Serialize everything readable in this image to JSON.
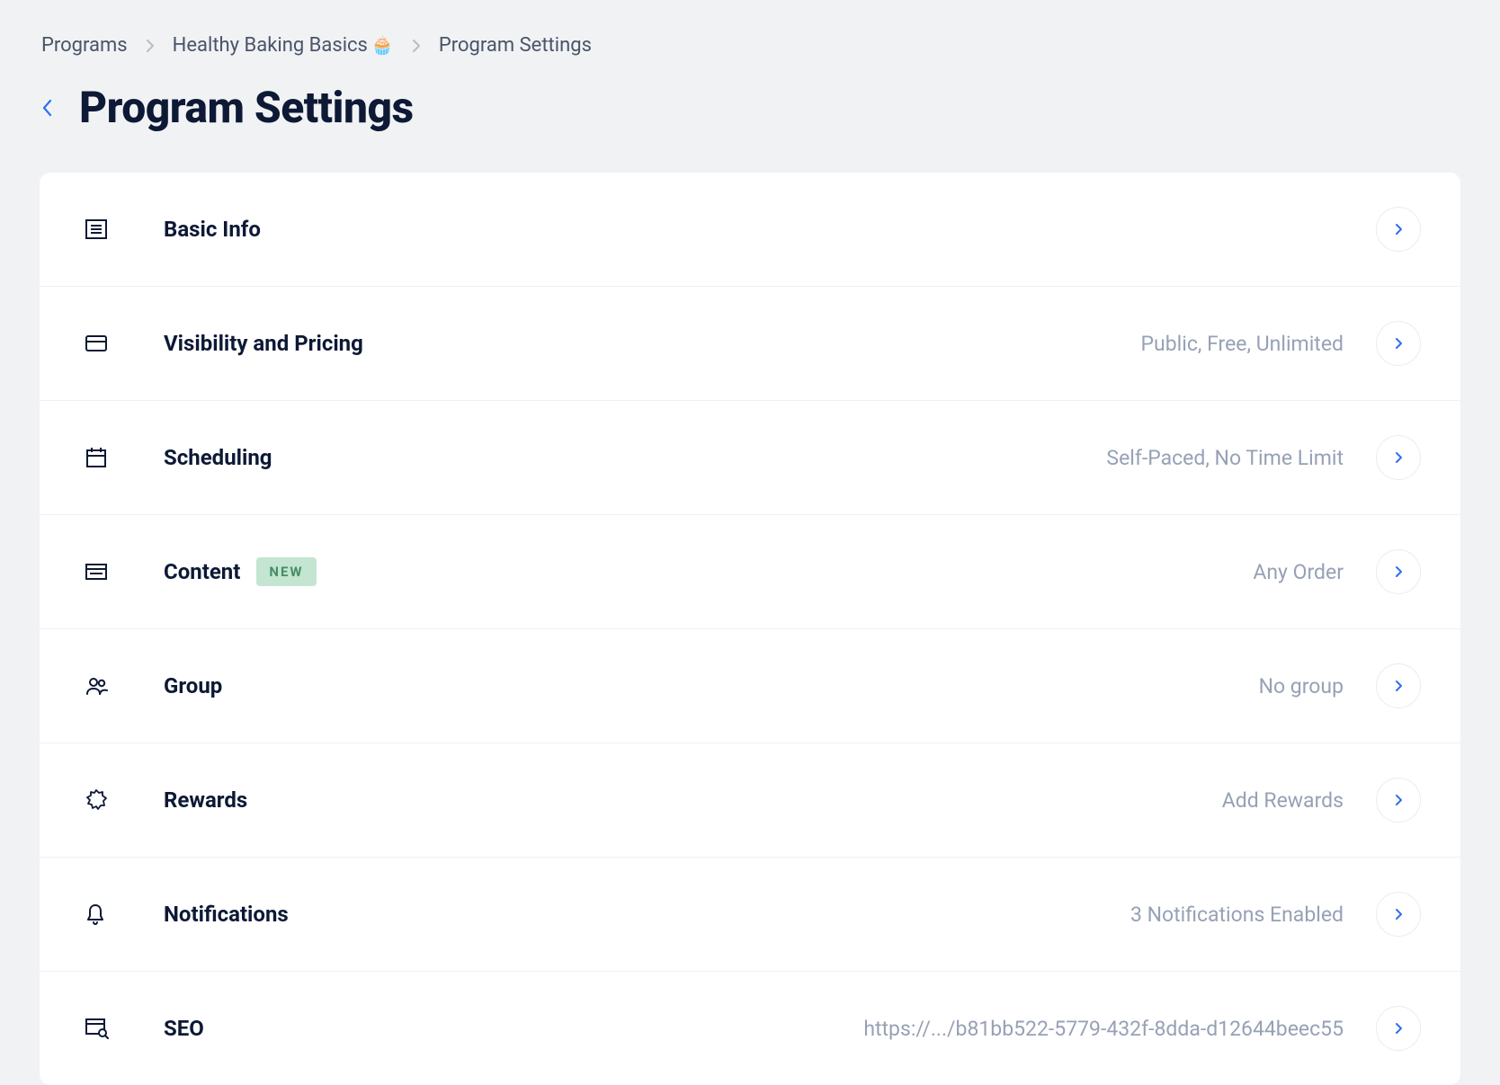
{
  "breadcrumb": {
    "root": "Programs",
    "program": "Healthy Baking Basics",
    "emoji": "🧁",
    "current": "Program Settings"
  },
  "page_title": "Program Settings",
  "rows": {
    "basic_info": {
      "label": "Basic Info",
      "value": ""
    },
    "visibility": {
      "label": "Visibility and Pricing",
      "value": "Public, Free, Unlimited"
    },
    "scheduling": {
      "label": "Scheduling",
      "value": "Self-Paced, No Time Limit"
    },
    "content": {
      "label": "Content",
      "value": "Any Order",
      "badge": "NEW"
    },
    "group": {
      "label": "Group",
      "value": "No group"
    },
    "rewards": {
      "label": "Rewards",
      "value": "Add Rewards"
    },
    "notifications": {
      "label": "Notifications",
      "value": "3 Notifications Enabled"
    },
    "seo": {
      "label": "SEO",
      "value": "https://.../b81bb522-5779-432f-8dda-d12644beec55"
    }
  }
}
